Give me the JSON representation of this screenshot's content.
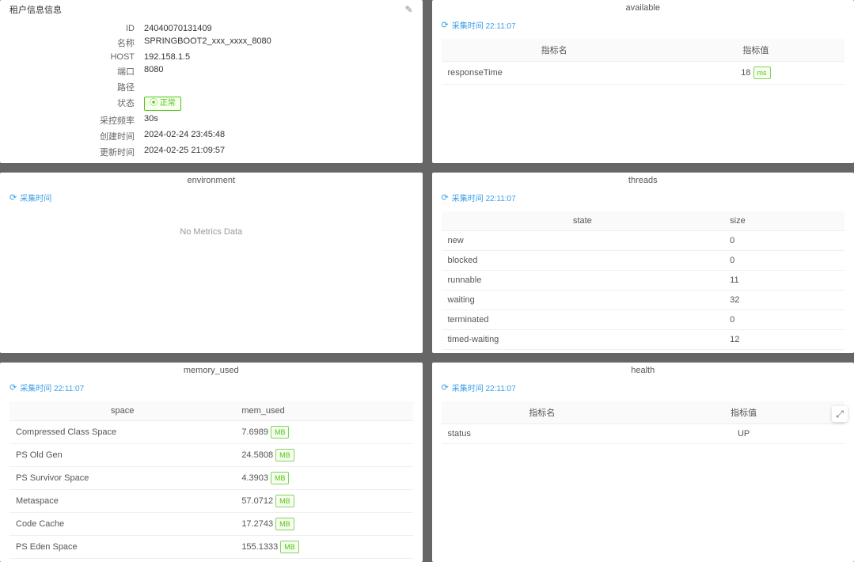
{
  "panels": {
    "lineInfo": {
      "title": "租户信息信息",
      "editIcon": "edit-icon",
      "rows": [
        {
          "label": "ID",
          "value": "24040070131409"
        },
        {
          "label": "名称",
          "value": "SPRINGBOOT2_xxx_xxxx_8080"
        },
        {
          "label": "HOST",
          "value": "192.158.1.5"
        },
        {
          "label": "端口",
          "value": "8080"
        },
        {
          "label": "路径",
          "value": ""
        },
        {
          "label": "状态",
          "value": "",
          "tag": "正常",
          "tagIcon": "⦿"
        },
        {
          "label": "采控频率",
          "value": "30s"
        },
        {
          "label": "创建时间",
          "value": "2024-02-24 23:45:48"
        },
        {
          "label": "更新时间",
          "value": "2024-02-25 21:09:57"
        }
      ]
    },
    "available": {
      "subtitle": "available",
      "refresh": "采集时间 22:11:07",
      "headers": [
        "指标名",
        "指标值"
      ],
      "rows": [
        {
          "name": "responseTime",
          "value": "18",
          "unit": "ms"
        }
      ]
    },
    "environment": {
      "subtitle": "environment",
      "refresh": "采集时间",
      "noData": "No Metrics Data"
    },
    "threads": {
      "subtitle": "threads",
      "refresh": "采集时间 22:11:07",
      "headers": [
        "state",
        "size"
      ],
      "rows": [
        {
          "state": "new",
          "size": "0"
        },
        {
          "state": "blocked",
          "size": "0"
        },
        {
          "state": "runnable",
          "size": "11"
        },
        {
          "state": "waiting",
          "size": "32"
        },
        {
          "state": "terminated",
          "size": "0"
        },
        {
          "state": "timed-waiting",
          "size": "12"
        }
      ]
    },
    "memoryUsed": {
      "subtitle": "memory_used",
      "refresh": "采集时间 22:11:07",
      "headers": [
        "space",
        "mem_used"
      ],
      "rows": [
        {
          "space": "Compressed Class Space",
          "value": "7.6989",
          "unit": "MB"
        },
        {
          "space": "PS Old Gen",
          "value": "24.5808",
          "unit": "MB"
        },
        {
          "space": "PS Survivor Space",
          "value": "4.3903",
          "unit": "MB"
        },
        {
          "space": "Metaspace",
          "value": "57.0712",
          "unit": "MB"
        },
        {
          "space": "Code Cache",
          "value": "17.2743",
          "unit": "MB"
        },
        {
          "space": "PS Eden Space",
          "value": "155.1333",
          "unit": "MB"
        }
      ]
    },
    "health": {
      "subtitle": "health",
      "refresh": "采集时间 22:11:07",
      "headers": [
        "指标名",
        "指标值"
      ],
      "rows": [
        {
          "name": "status",
          "value": "UP"
        }
      ]
    }
  }
}
